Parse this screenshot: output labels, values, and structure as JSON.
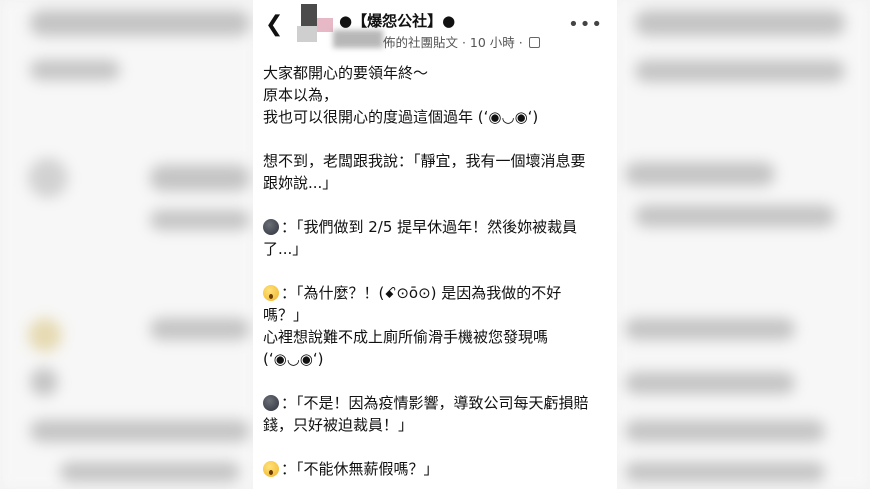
{
  "header": {
    "back_icon": "chevron-left-icon",
    "group_title": "●【爆怨公社】●",
    "meta_text": "佈的社團貼文 · 10 小時 · ",
    "privacy_icon": "group-icon",
    "more_icon": "more-horizontal-icon"
  },
  "post": {
    "lines": [
      "大家都開心的要領年終～",
      "原本以為，",
      "我也可以很開心的度過這個過年 (ʻ◉◡◉ʻ)",
      "",
      "想不到，老闆跟我說：「靜宜，我有一個壞消息要",
      "跟妳說...」",
      "",
      "：「我們做到 2/5 提早休過年！然後妳被裁員",
      "了...」",
      "",
      "：「為什麼？！(ꗃ⊙ō⊙) 是因為我做的不好",
      "嗎？」",
      "心裡想說難不成上廁所偷滑手機被您發現嗎",
      "(ʻ◉◡◉ʻ)",
      "",
      "：「不是！因為疫情影響，導致公司每天虧損賠",
      "錢，只好被迫裁員！」",
      "",
      "：「不能休無薪假嗎？」"
    ]
  }
}
